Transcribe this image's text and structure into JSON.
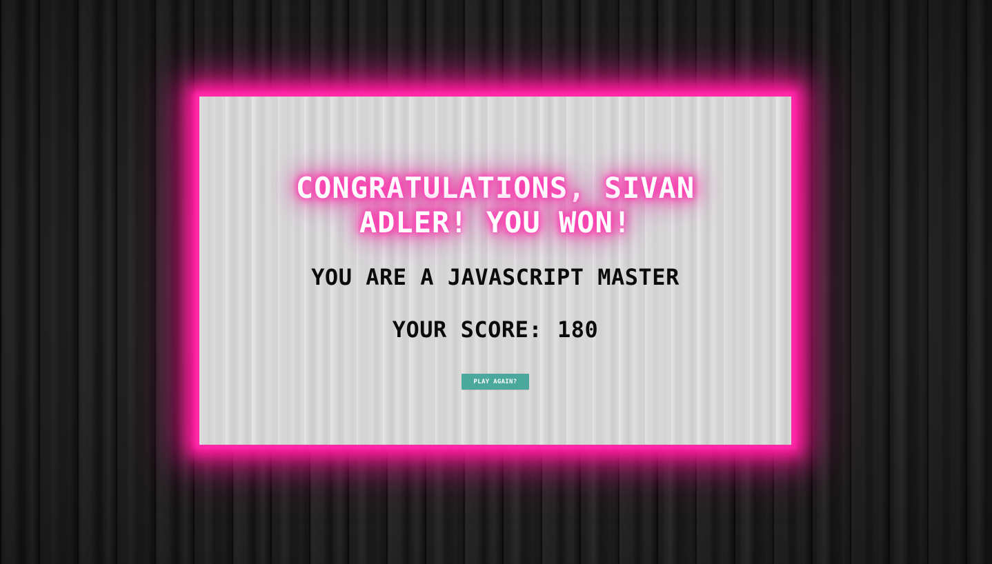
{
  "result": {
    "headline_line1": "Congratulations, Sivan",
    "headline_line2": "Adler! You won!",
    "rank_message": "You are a JavaScript master",
    "score_label": "Your score:",
    "score_value": "180"
  },
  "actions": {
    "play_again_label": "Play again?"
  },
  "colors": {
    "neon_glow": "#ff1fa0",
    "panel_background": "#d9d9d9",
    "button_background": "#4aa99c",
    "page_background": "#1b1b1b"
  }
}
